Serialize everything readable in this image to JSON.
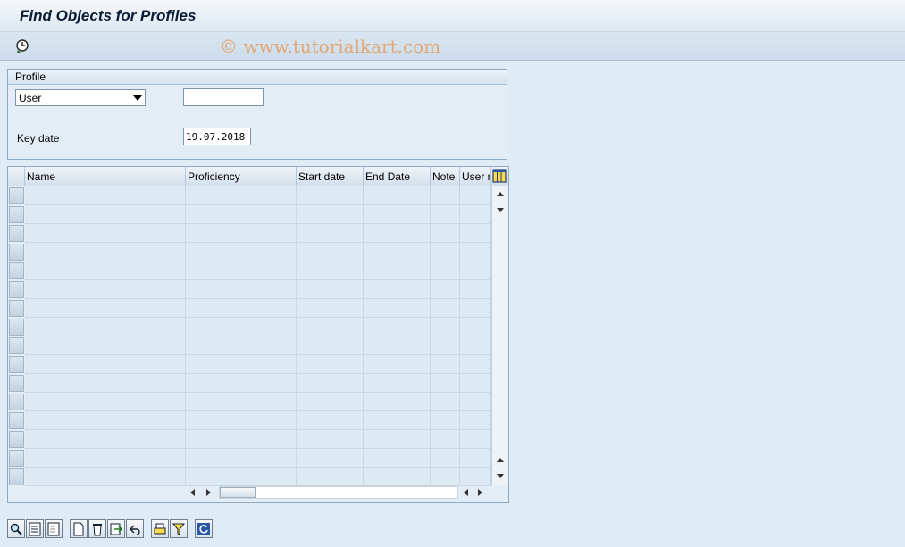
{
  "window": {
    "title": "Find Objects for Profiles"
  },
  "toolbar": {
    "execute_icon": "clock-execute-icon"
  },
  "watermark": "© www.tutorialkart.com",
  "profile_group": {
    "title": "Profile",
    "object_type": {
      "selected": "User"
    },
    "object_value": "",
    "key_date_label": "Key date",
    "key_date_value": "19.07.2018"
  },
  "grid": {
    "columns": [
      "Name",
      "Proficiency",
      "Start date",
      "End Date",
      "Note",
      "User r"
    ],
    "row_count": 16
  },
  "bottom_toolbar": {
    "icons": [
      "details-icon",
      "select-all-icon",
      "deselect-icon",
      "new-icon",
      "delete-icon",
      "export-icon",
      "undo-icon",
      "print-icon",
      "filter-icon",
      "refresh-icon"
    ]
  },
  "colors": {
    "background": "#dfebf5",
    "title_text": "#0b1b33",
    "watermark": "#e6964f"
  }
}
